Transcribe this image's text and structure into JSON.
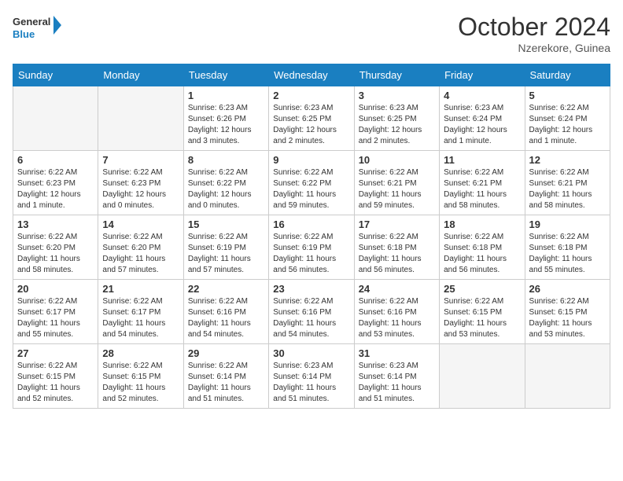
{
  "header": {
    "logo_line1": "General",
    "logo_line2": "Blue",
    "month_title": "October 2024",
    "location": "Nzerekore, Guinea"
  },
  "weekdays": [
    "Sunday",
    "Monday",
    "Tuesday",
    "Wednesday",
    "Thursday",
    "Friday",
    "Saturday"
  ],
  "weeks": [
    [
      {
        "day": "",
        "empty": true
      },
      {
        "day": "",
        "empty": true
      },
      {
        "day": "1",
        "sunrise": "Sunrise: 6:23 AM",
        "sunset": "Sunset: 6:26 PM",
        "daylight": "Daylight: 12 hours and 3 minutes."
      },
      {
        "day": "2",
        "sunrise": "Sunrise: 6:23 AM",
        "sunset": "Sunset: 6:25 PM",
        "daylight": "Daylight: 12 hours and 2 minutes."
      },
      {
        "day": "3",
        "sunrise": "Sunrise: 6:23 AM",
        "sunset": "Sunset: 6:25 PM",
        "daylight": "Daylight: 12 hours and 2 minutes."
      },
      {
        "day": "4",
        "sunrise": "Sunrise: 6:23 AM",
        "sunset": "Sunset: 6:24 PM",
        "daylight": "Daylight: 12 hours and 1 minute."
      },
      {
        "day": "5",
        "sunrise": "Sunrise: 6:22 AM",
        "sunset": "Sunset: 6:24 PM",
        "daylight": "Daylight: 12 hours and 1 minute."
      }
    ],
    [
      {
        "day": "6",
        "sunrise": "Sunrise: 6:22 AM",
        "sunset": "Sunset: 6:23 PM",
        "daylight": "Daylight: 12 hours and 1 minute."
      },
      {
        "day": "7",
        "sunrise": "Sunrise: 6:22 AM",
        "sunset": "Sunset: 6:23 PM",
        "daylight": "Daylight: 12 hours and 0 minutes."
      },
      {
        "day": "8",
        "sunrise": "Sunrise: 6:22 AM",
        "sunset": "Sunset: 6:22 PM",
        "daylight": "Daylight: 12 hours and 0 minutes."
      },
      {
        "day": "9",
        "sunrise": "Sunrise: 6:22 AM",
        "sunset": "Sunset: 6:22 PM",
        "daylight": "Daylight: 11 hours and 59 minutes."
      },
      {
        "day": "10",
        "sunrise": "Sunrise: 6:22 AM",
        "sunset": "Sunset: 6:21 PM",
        "daylight": "Daylight: 11 hours and 59 minutes."
      },
      {
        "day": "11",
        "sunrise": "Sunrise: 6:22 AM",
        "sunset": "Sunset: 6:21 PM",
        "daylight": "Daylight: 11 hours and 58 minutes."
      },
      {
        "day": "12",
        "sunrise": "Sunrise: 6:22 AM",
        "sunset": "Sunset: 6:21 PM",
        "daylight": "Daylight: 11 hours and 58 minutes."
      }
    ],
    [
      {
        "day": "13",
        "sunrise": "Sunrise: 6:22 AM",
        "sunset": "Sunset: 6:20 PM",
        "daylight": "Daylight: 11 hours and 58 minutes."
      },
      {
        "day": "14",
        "sunrise": "Sunrise: 6:22 AM",
        "sunset": "Sunset: 6:20 PM",
        "daylight": "Daylight: 11 hours and 57 minutes."
      },
      {
        "day": "15",
        "sunrise": "Sunrise: 6:22 AM",
        "sunset": "Sunset: 6:19 PM",
        "daylight": "Daylight: 11 hours and 57 minutes."
      },
      {
        "day": "16",
        "sunrise": "Sunrise: 6:22 AM",
        "sunset": "Sunset: 6:19 PM",
        "daylight": "Daylight: 11 hours and 56 minutes."
      },
      {
        "day": "17",
        "sunrise": "Sunrise: 6:22 AM",
        "sunset": "Sunset: 6:18 PM",
        "daylight": "Daylight: 11 hours and 56 minutes."
      },
      {
        "day": "18",
        "sunrise": "Sunrise: 6:22 AM",
        "sunset": "Sunset: 6:18 PM",
        "daylight": "Daylight: 11 hours and 56 minutes."
      },
      {
        "day": "19",
        "sunrise": "Sunrise: 6:22 AM",
        "sunset": "Sunset: 6:18 PM",
        "daylight": "Daylight: 11 hours and 55 minutes."
      }
    ],
    [
      {
        "day": "20",
        "sunrise": "Sunrise: 6:22 AM",
        "sunset": "Sunset: 6:17 PM",
        "daylight": "Daylight: 11 hours and 55 minutes."
      },
      {
        "day": "21",
        "sunrise": "Sunrise: 6:22 AM",
        "sunset": "Sunset: 6:17 PM",
        "daylight": "Daylight: 11 hours and 54 minutes."
      },
      {
        "day": "22",
        "sunrise": "Sunrise: 6:22 AM",
        "sunset": "Sunset: 6:16 PM",
        "daylight": "Daylight: 11 hours and 54 minutes."
      },
      {
        "day": "23",
        "sunrise": "Sunrise: 6:22 AM",
        "sunset": "Sunset: 6:16 PM",
        "daylight": "Daylight: 11 hours and 54 minutes."
      },
      {
        "day": "24",
        "sunrise": "Sunrise: 6:22 AM",
        "sunset": "Sunset: 6:16 PM",
        "daylight": "Daylight: 11 hours and 53 minutes."
      },
      {
        "day": "25",
        "sunrise": "Sunrise: 6:22 AM",
        "sunset": "Sunset: 6:15 PM",
        "daylight": "Daylight: 11 hours and 53 minutes."
      },
      {
        "day": "26",
        "sunrise": "Sunrise: 6:22 AM",
        "sunset": "Sunset: 6:15 PM",
        "daylight": "Daylight: 11 hours and 53 minutes."
      }
    ],
    [
      {
        "day": "27",
        "sunrise": "Sunrise: 6:22 AM",
        "sunset": "Sunset: 6:15 PM",
        "daylight": "Daylight: 11 hours and 52 minutes."
      },
      {
        "day": "28",
        "sunrise": "Sunrise: 6:22 AM",
        "sunset": "Sunset: 6:15 PM",
        "daylight": "Daylight: 11 hours and 52 minutes."
      },
      {
        "day": "29",
        "sunrise": "Sunrise: 6:22 AM",
        "sunset": "Sunset: 6:14 PM",
        "daylight": "Daylight: 11 hours and 51 minutes."
      },
      {
        "day": "30",
        "sunrise": "Sunrise: 6:23 AM",
        "sunset": "Sunset: 6:14 PM",
        "daylight": "Daylight: 11 hours and 51 minutes."
      },
      {
        "day": "31",
        "sunrise": "Sunrise: 6:23 AM",
        "sunset": "Sunset: 6:14 PM",
        "daylight": "Daylight: 11 hours and 51 minutes."
      },
      {
        "day": "",
        "empty": true
      },
      {
        "day": "",
        "empty": true
      }
    ]
  ]
}
